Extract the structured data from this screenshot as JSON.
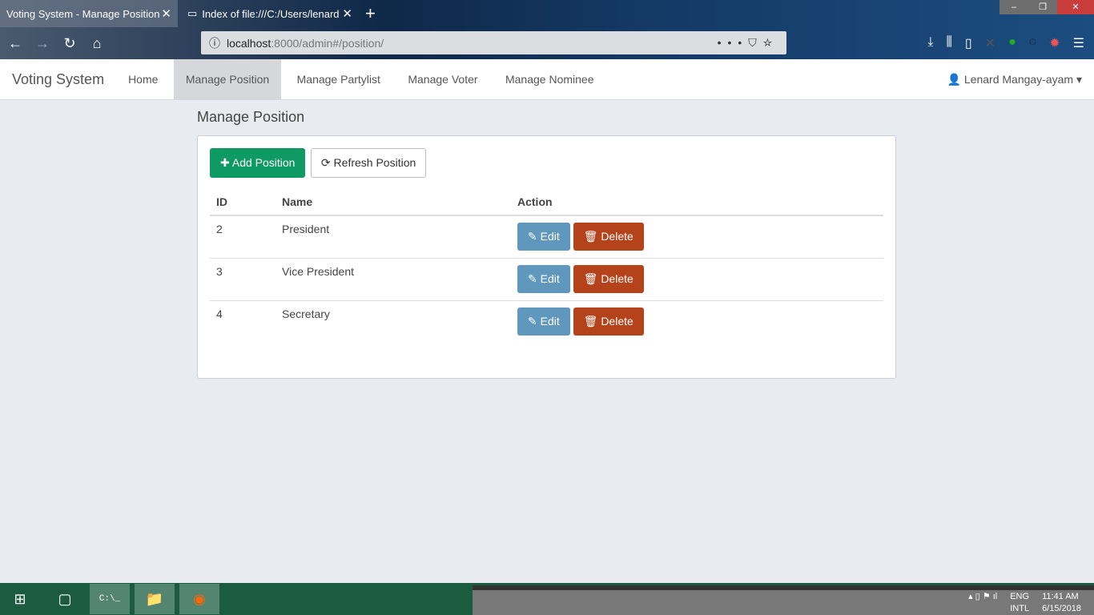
{
  "browser": {
    "tabs": [
      {
        "label": "Voting System - Manage Position"
      },
      {
        "label": "Index of file:///C:/Users/lenard"
      }
    ],
    "url_host": "localhost",
    "url_rest": ":8000/admin#/position/"
  },
  "navbar": {
    "brand": "Voting System",
    "items": [
      "Home",
      "Manage Position",
      "Manage Partylist",
      "Manage Voter",
      "Manage Nominee"
    ],
    "active": "Manage Position",
    "user": "Lenard Mangay-ayam"
  },
  "page": {
    "title": "Manage Position",
    "add_label": "Add Position",
    "refresh_label": "Refresh Position",
    "columns": [
      "ID",
      "Name",
      "Action"
    ],
    "rows": [
      {
        "id": "2",
        "name": "President"
      },
      {
        "id": "3",
        "name": "Vice President"
      },
      {
        "id": "4",
        "name": "Secretary"
      }
    ],
    "edit_label": "Edit",
    "delete_label": "Delete"
  },
  "taskbar": {
    "lang1": "ENG",
    "lang2": "INTL",
    "time": "11:41 AM",
    "date": "6/15/2018"
  },
  "colors": {
    "add": "#0f9a63",
    "edit": "#5f97bd",
    "delete": "#b4421a"
  }
}
